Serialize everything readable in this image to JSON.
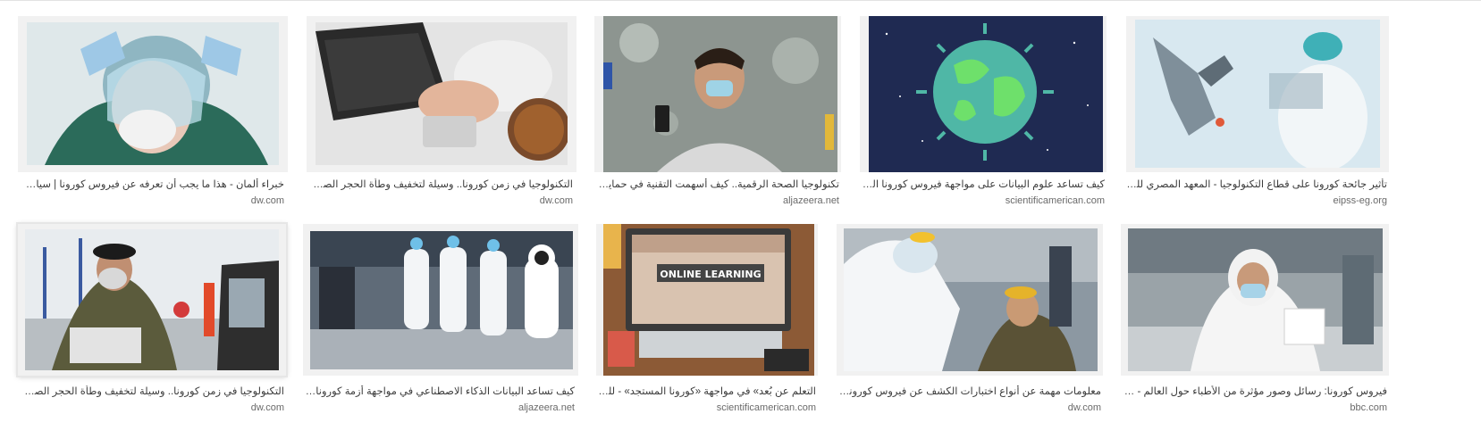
{
  "results": [
    {
      "caption": "خبراء ألمان - هذا ما يجب أن تعرفه عن فيروس كورونا | سياسة واقتصاد | تقارير",
      "source": "dw.com",
      "image": "medical worker with face shield"
    },
    {
      "caption": "التكنولوجيا في زمن كورونا.. وسيلة لتخفيف وطأة الحجر الصحي | أخبار W...",
      "source": "dw.com",
      "image": "hands on keyboard with pills and tea"
    },
    {
      "caption": "تكنولوجيا الصحة الرقمية.. كيف أسهمت التقنية في حماية البشر من كو...",
      "source": "aljazeera.net",
      "image": "man with mask and phone"
    },
    {
      "caption": "كيف تساعد علوم البيانات على مواجهة فيروس كورونا المستجد؟ - للعلم",
      "source": "scientificamerican.com",
      "image": "earth shaped like virus"
    },
    {
      "caption": "تأثير جائحة كورونا على قطاع التكنولوجيا - المعهد المصري للدراسات",
      "source": "eipss-eg.org",
      "image": "robot arm in lab"
    },
    {
      "caption": "التكنولوجيا في زمن كورونا.. وسيلة لتخفيف وطأة الحجر الصحي | أخبار W...",
      "source": "dw.com",
      "image": "soldier with gas mask at checkpoint"
    },
    {
      "caption": "كيف تساعد البيانات الذكاء الاصطناعي في مواجهة أزمة كورونا؟ | الجزيرة نت",
      "source": "aljazeera.net",
      "image": "medics with robot in hospital"
    },
    {
      "caption": "التعلم عن بُعد» في مواجهة «كورونا المستجد» - للعلم",
      "source": "scientificamerican.com",
      "image": "online learning laptop"
    },
    {
      "caption": "معلومات مهمة عن أنواع اختبارات الكشف عن فيروس كورونا المستجد | عل...",
      "source": "dw.com",
      "image": "swab test"
    },
    {
      "caption": "فيروس كورونا: رسائل وصور مؤثرة من الأطباء حول العالم - BBC News",
      "source": "bbc.com",
      "image": "doctor in hijab with mask"
    }
  ]
}
